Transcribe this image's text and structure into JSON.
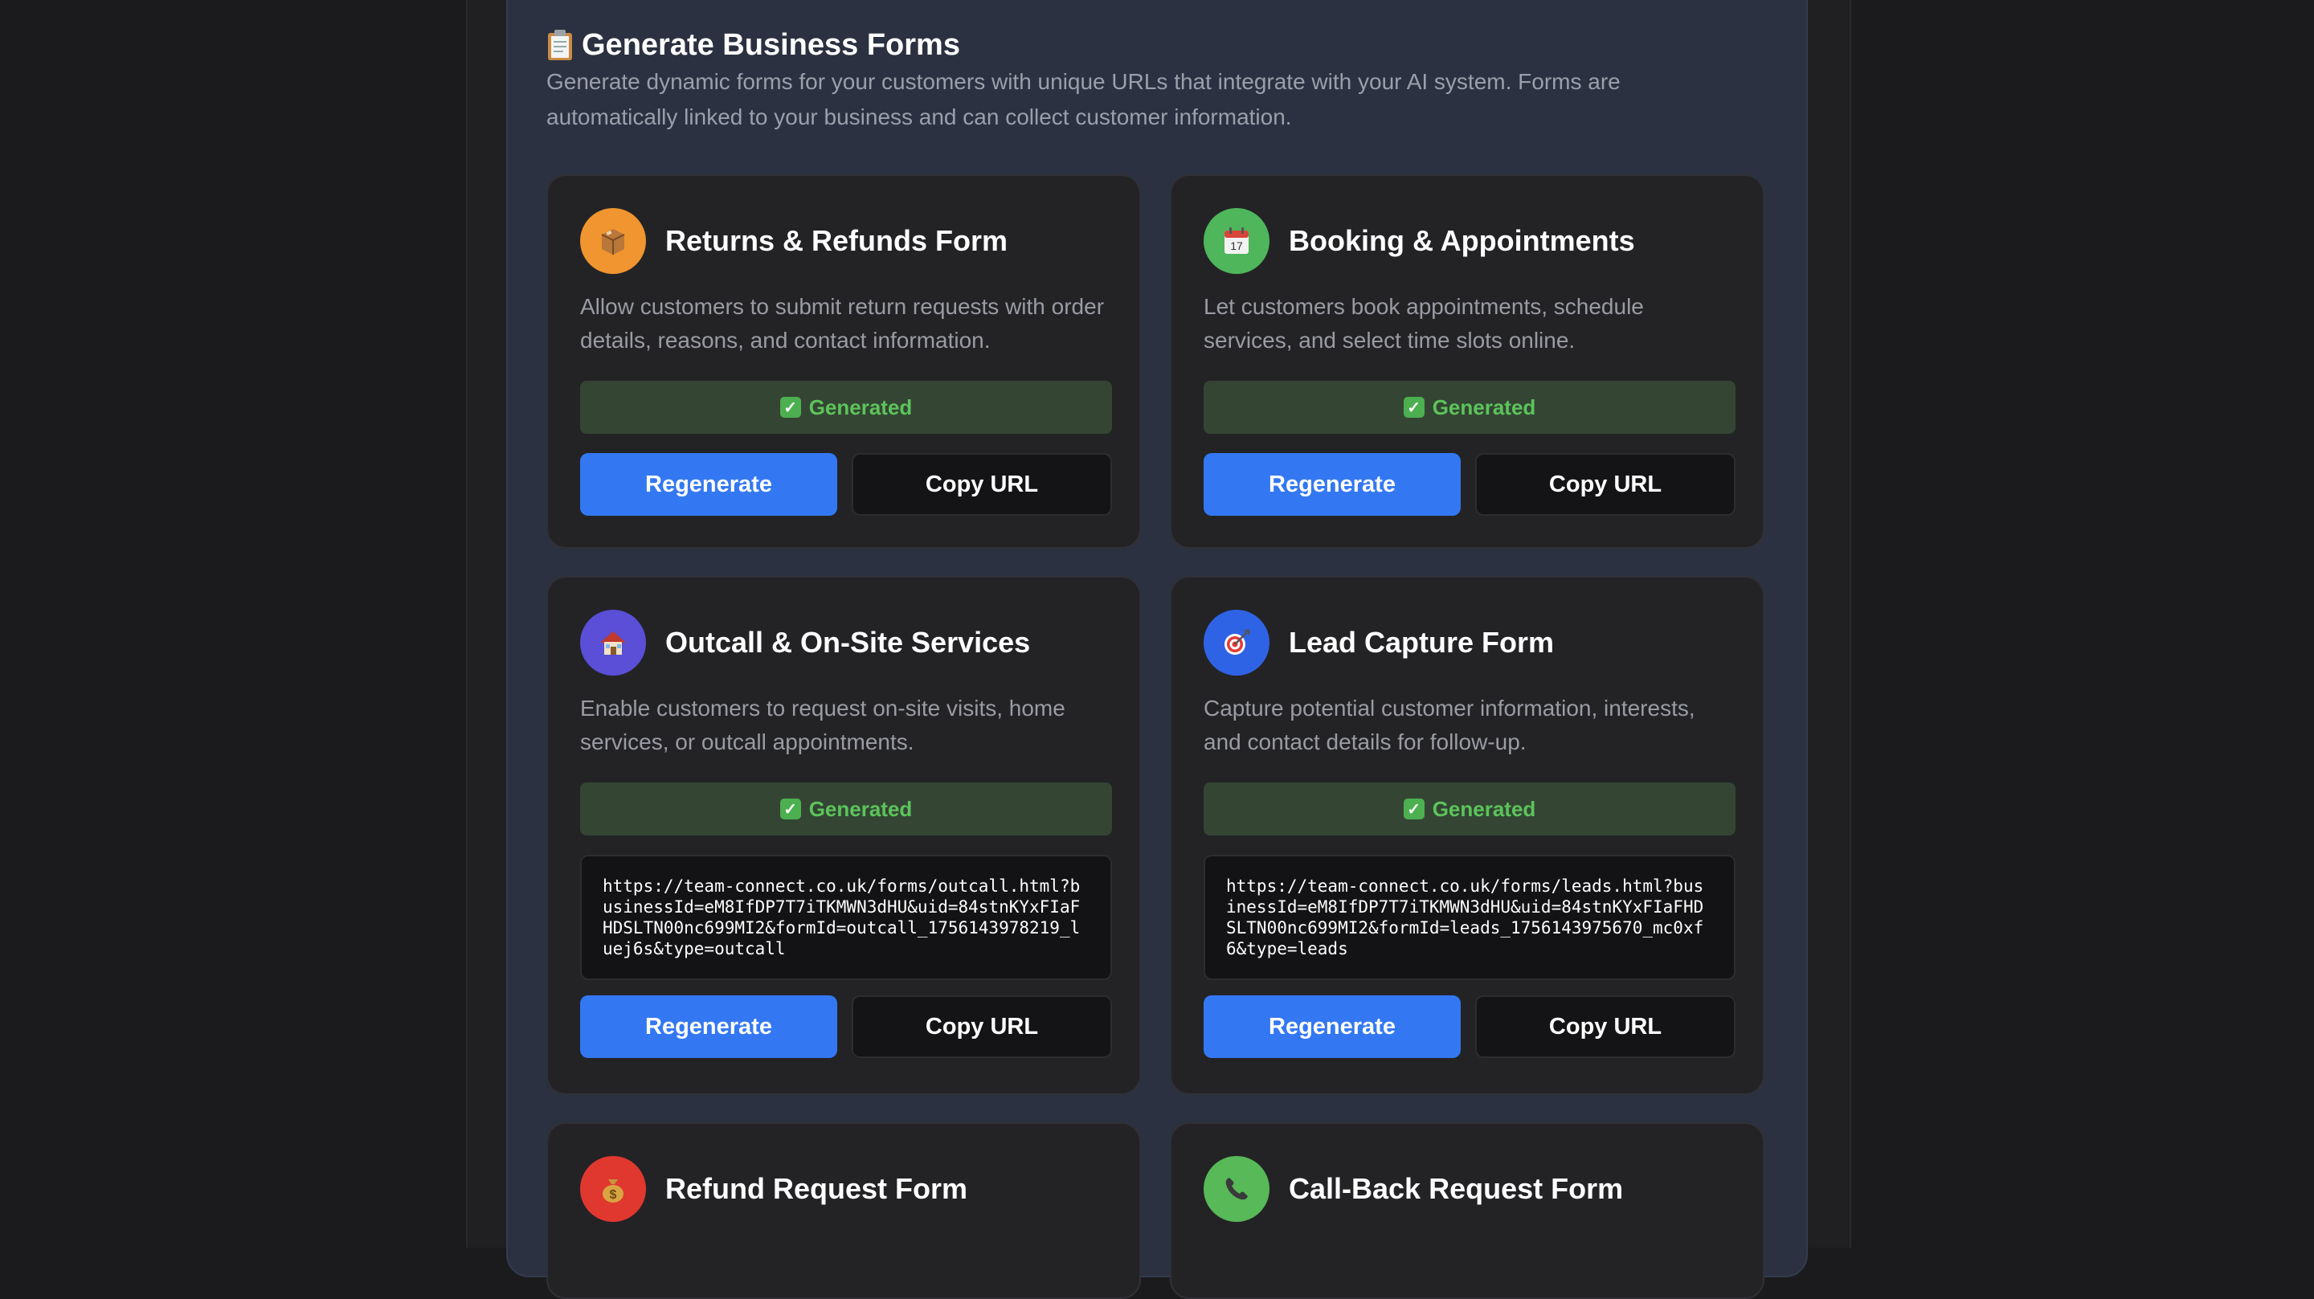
{
  "panel": {
    "title": "Generate Business Forms",
    "description": "Generate dynamic forms for your customers with unique URLs that integrate with your AI system. Forms are automatically linked to your business and can collect customer information."
  },
  "colors": {
    "primary": "#3378f2",
    "success": "#5cc45a",
    "returns": "#f0952f",
    "booking": "#4fb65b",
    "outcall": "#5a4fd6",
    "leads": "#2f63e6",
    "refund": "#e0382f",
    "callback": "#57b957"
  },
  "cards": [
    {
      "title": "Returns & Refunds Form",
      "icon": "package-icon",
      "description": "Allow customers to submit return requests with order details, reasons, and contact information.",
      "status": "Generated",
      "regenerate_label": "Regenerate",
      "copy_label": "Copy URL"
    },
    {
      "title": "Booking & Appointments",
      "icon": "calendar-icon",
      "description": "Let customers book appointments, schedule services, and select time slots online.",
      "status": "Generated",
      "regenerate_label": "Regenerate",
      "copy_label": "Copy URL"
    },
    {
      "title": "Outcall & On-Site Services",
      "icon": "house-icon",
      "description": "Enable customers to request on-site visits, home services, or outcall appointments.",
      "status": "Generated",
      "url": "https://team-connect.co.uk/forms/outcall.html?businessId=eM8IfDP7T7iTKMWN3dHU&uid=84stnKYxFIaFHDSLTN00nc699MI2&formId=outcall_1756143978219_luej6s&type=outcall",
      "regenerate_label": "Regenerate",
      "copy_label": "Copy URL"
    },
    {
      "title": "Lead Capture Form",
      "icon": "target-icon",
      "description": "Capture potential customer information, interests, and contact details for follow-up.",
      "status": "Generated",
      "url": "https://team-connect.co.uk/forms/leads.html?businessId=eM8IfDP7T7iTKMWN3dHU&uid=84stnKYxFIaFHDSLTN00nc699MI2&formId=leads_1756143975670_mc0xf6&type=leads",
      "regenerate_label": "Regenerate",
      "copy_label": "Copy URL"
    },
    {
      "title": "Refund Request Form",
      "icon": "money-bag-icon"
    },
    {
      "title": "Call-Back Request Form",
      "icon": "phone-icon"
    }
  ]
}
